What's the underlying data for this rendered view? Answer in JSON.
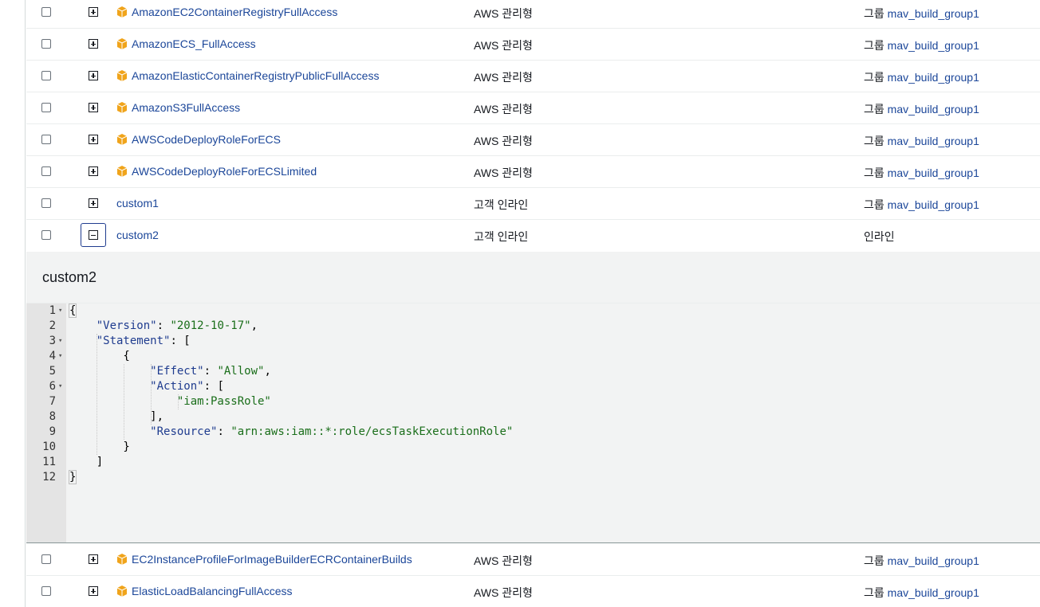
{
  "colors": {
    "link": "#1b4699",
    "icon": "#f0a41b",
    "json_key": "#1f3c8f",
    "json_string": "#1a6e1a"
  },
  "rows_top": [
    {
      "name": "AmazonEC2ContainerRegistryFullAccess",
      "type": "AWS 관리형",
      "via_label": "그룹",
      "via_link": "mav_build_group1",
      "icon": "package-icon"
    },
    {
      "name": "AmazonECS_FullAccess",
      "type": "AWS 관리형",
      "via_label": "그룹",
      "via_link": "mav_build_group1",
      "icon": "package-icon"
    },
    {
      "name": "AmazonElasticContainerRegistryPublicFullAccess",
      "type": "AWS 관리형",
      "via_label": "그룹",
      "via_link": "mav_build_group1",
      "icon": "package-icon"
    },
    {
      "name": "AmazonS3FullAccess",
      "type": "AWS 관리형",
      "via_label": "그룹",
      "via_link": "mav_build_group1",
      "icon": "package-icon"
    },
    {
      "name": "AWSCodeDeployRoleForECS",
      "type": "AWS 관리형",
      "via_label": "그룹",
      "via_link": "mav_build_group1",
      "icon": "package-icon"
    },
    {
      "name": "AWSCodeDeployRoleForECSLimited",
      "type": "AWS 관리형",
      "via_label": "그룹",
      "via_link": "mav_build_group1",
      "icon": "package-icon"
    },
    {
      "name": "custom1",
      "type": "고객 인라인",
      "via_label": "그룹",
      "via_link": "mav_build_group1"
    },
    {
      "name": "custom2",
      "type": "고객 인라인",
      "via_label": "인라인",
      "via_link": ""
    }
  ],
  "detail": {
    "title": "custom2",
    "line_numbers": [
      "1",
      "2",
      "3",
      "4",
      "5",
      "6",
      "7",
      "8",
      "9",
      "10",
      "11",
      "12"
    ],
    "code": {
      "l2_key": "\"Version\"",
      "l2_val": "\"2012-10-17\"",
      "l3_key": "\"Statement\"",
      "l5_key": "\"Effect\"",
      "l5_val": "\"Allow\"",
      "l6_key": "\"Action\"",
      "l7_val": "\"iam:PassRole\"",
      "l9_key": "\"Resource\"",
      "l9_val": "\"arn:aws:iam::*:role/ecsTaskExecutionRole\""
    }
  },
  "rows_bottom": [
    {
      "name": "EC2InstanceProfileForImageBuilderECRContainerBuilds",
      "type": "AWS 관리형",
      "via_label": "그룹",
      "via_link": "mav_build_group1",
      "icon": "package-icon"
    },
    {
      "name": "ElasticLoadBalancingFullAccess",
      "type": "AWS 관리형",
      "via_label": "그룹",
      "via_link": "mav_build_group1",
      "icon": "package-icon"
    }
  ]
}
